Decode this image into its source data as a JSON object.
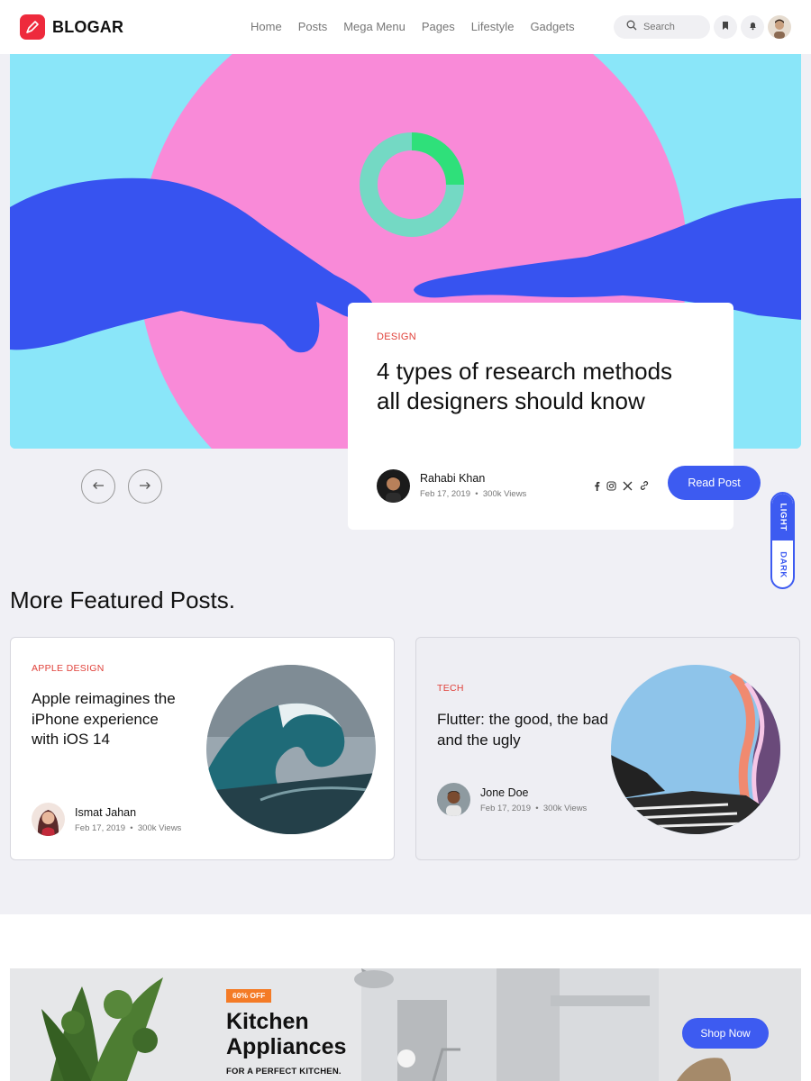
{
  "header": {
    "logo_text": "BLOGAR",
    "nav": [
      "Home",
      "Posts",
      "Mega Menu",
      "Pages",
      "Lifestyle",
      "Gadgets"
    ],
    "search": {
      "placeholder": "Search"
    },
    "icons": [
      "search-icon",
      "bookmark-icon",
      "bell-icon",
      "user-avatar"
    ]
  },
  "hero": {
    "category": "DESIGN",
    "title": "4 types of research methods all designers should know",
    "author": {
      "name": "Rahabi Khan",
      "date": "Feb 17, 2019",
      "views": "300k Views"
    },
    "social_icons": [
      "facebook-icon",
      "instagram-icon",
      "x-icon",
      "link-icon"
    ],
    "read_button": "Read Post"
  },
  "theme_toggle": {
    "light": "LIGHT",
    "dark": "DARK"
  },
  "featured": {
    "title": "More Featured Posts.",
    "posts": [
      {
        "category": "APPLE DESIGN",
        "title": "Apple reimagines the iPhone experience with iOS 14",
        "author": "Ismat Jahan",
        "date": "Feb 17, 2019",
        "views": "300k Views"
      },
      {
        "category": "TECH",
        "title": "Flutter: the good, the bad and the ugly",
        "author": "Jone Doe",
        "date": "Feb 17, 2019",
        "views": "300k Views"
      }
    ]
  },
  "promo": {
    "badge": "60% OFF",
    "title": "Kitchen Appliances",
    "subtitle": "FOR A PERFECT KITCHEN.",
    "button": "Shop Now"
  },
  "colors": {
    "accent": "#3d5bf1",
    "category": "#e0413a",
    "logo": "#ee2a3c",
    "badge": "#f47b26"
  }
}
